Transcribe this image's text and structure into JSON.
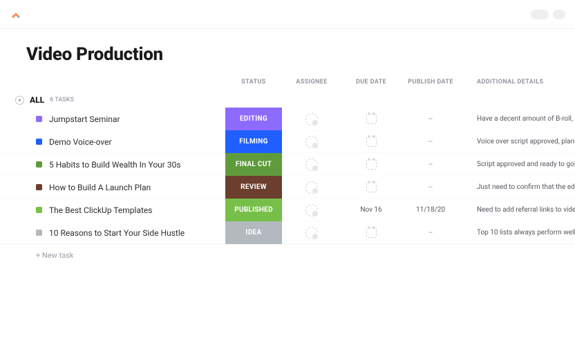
{
  "page_title": "Video Production",
  "group": {
    "name": "ALL",
    "count_label": "6 TASKS"
  },
  "columns": {
    "status": "STATUS",
    "assignee": "ASSIGNEE",
    "due_date": "DUE DATE",
    "publish_date": "PUBLISH DATE",
    "details": "ADDITIONAL DETAILS"
  },
  "new_task_label": "+ New task",
  "status_colors": {
    "EDITING": "#8e6bff",
    "FILMING": "#1f5fff",
    "FINAL CUT": "#5f9b3c",
    "REVIEW": "#6b3e2e",
    "PUBLISHED": "#76c049",
    "IDEA": "#b4b8bf"
  },
  "square_colors": {
    "purple": "#8e6bff",
    "blue": "#1f5fff",
    "green": "#5f9b3c",
    "brown": "#6b3e2e",
    "lime": "#76c049",
    "grey": "#b4b8bf"
  },
  "tasks": [
    {
      "name": "Jumpstart Seminar",
      "status": "EDITING",
      "square": "purple",
      "due": "",
      "publish": "–",
      "details": "Have a decent amount of B-roll, ma"
    },
    {
      "name": "Demo Voice-over",
      "status": "FILMING",
      "square": "blue",
      "due": "",
      "publish": "–",
      "details": "Voice over script approved, plannin"
    },
    {
      "name": "5 Habits to Build Wealth In Your 30s",
      "status": "FINAL CUT",
      "square": "green",
      "due": "",
      "publish": "–",
      "details": "Script approved and ready to go!"
    },
    {
      "name": "How to Build A Launch Plan",
      "status": "REVIEW",
      "square": "brown",
      "due": "",
      "publish": "–",
      "details": "Just need to confirm that the edite"
    },
    {
      "name": "The Best ClickUp Templates",
      "status": "PUBLISHED",
      "square": "lime",
      "due": "Nov 16",
      "publish": "11/18/20",
      "details": "Need to add referral links to video a"
    },
    {
      "name": "10 Reasons to Start Your Side Hustle",
      "status": "IDEA",
      "square": "grey",
      "due": "",
      "publish": "–",
      "details": "Top 10 lists always perform well"
    }
  ]
}
